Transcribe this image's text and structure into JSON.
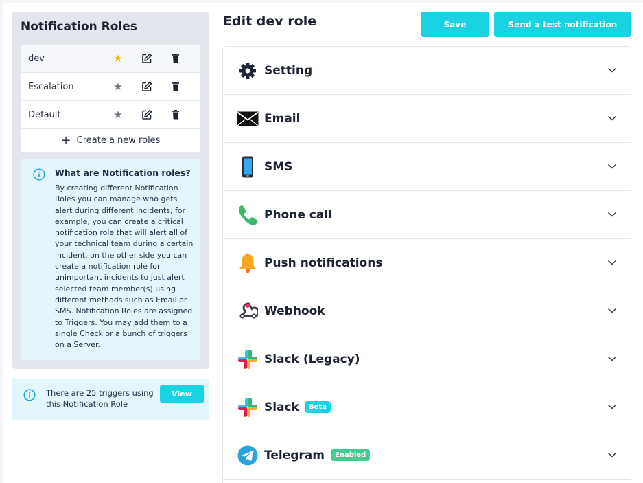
{
  "sidebar": {
    "title": "Notification Roles",
    "roles": [
      {
        "name": "dev",
        "default": true
      },
      {
        "name": "Escalation",
        "default": false
      },
      {
        "name": "Default",
        "default": false
      }
    ],
    "create_label": "Create a new roles",
    "info": {
      "title": "What are Notification roles?",
      "text": "By creating different Notification Roles you can manage who gets alert during different incidents, for example, you can create a critical notification role that will alert all of your technical team during a certain incident, on the other side you can create a notification role for unimportant incidents to just alert selected team member(s) using different methods such as Email or SMS. Notification Roles are assigned to Triggers. You may add them to a single Check or a bunch of triggers on a Server."
    },
    "triggers": {
      "text": "There are 25 triggers using this Notification Role",
      "view_label": "View"
    }
  },
  "main": {
    "title": "Edit dev role",
    "save_label": "Save",
    "test_label": "Send a test notification",
    "sections": [
      {
        "label": "Setting",
        "icon": "gear-icon"
      },
      {
        "label": "Email",
        "icon": "envelope-icon"
      },
      {
        "label": "SMS",
        "icon": "mobile-phone-icon"
      },
      {
        "label": "Phone call",
        "icon": "phone-handset-icon"
      },
      {
        "label": "Push notifications",
        "icon": "bell-icon"
      },
      {
        "label": "Webhook",
        "icon": "webhook-icon"
      },
      {
        "label": "Slack (Legacy)",
        "icon": "slack-icon"
      },
      {
        "label": "Slack",
        "icon": "slack-icon",
        "badge": "Beta"
      },
      {
        "label": "Telegram",
        "icon": "telegram-icon",
        "badge": "Enabled"
      }
    ]
  },
  "colors": {
    "accent": "#19d3e3",
    "star_active": "#f5b800",
    "star_inactive": "#6b7280",
    "badge_beta": "#19d3e3",
    "badge_enabled": "#3ecf8e"
  }
}
